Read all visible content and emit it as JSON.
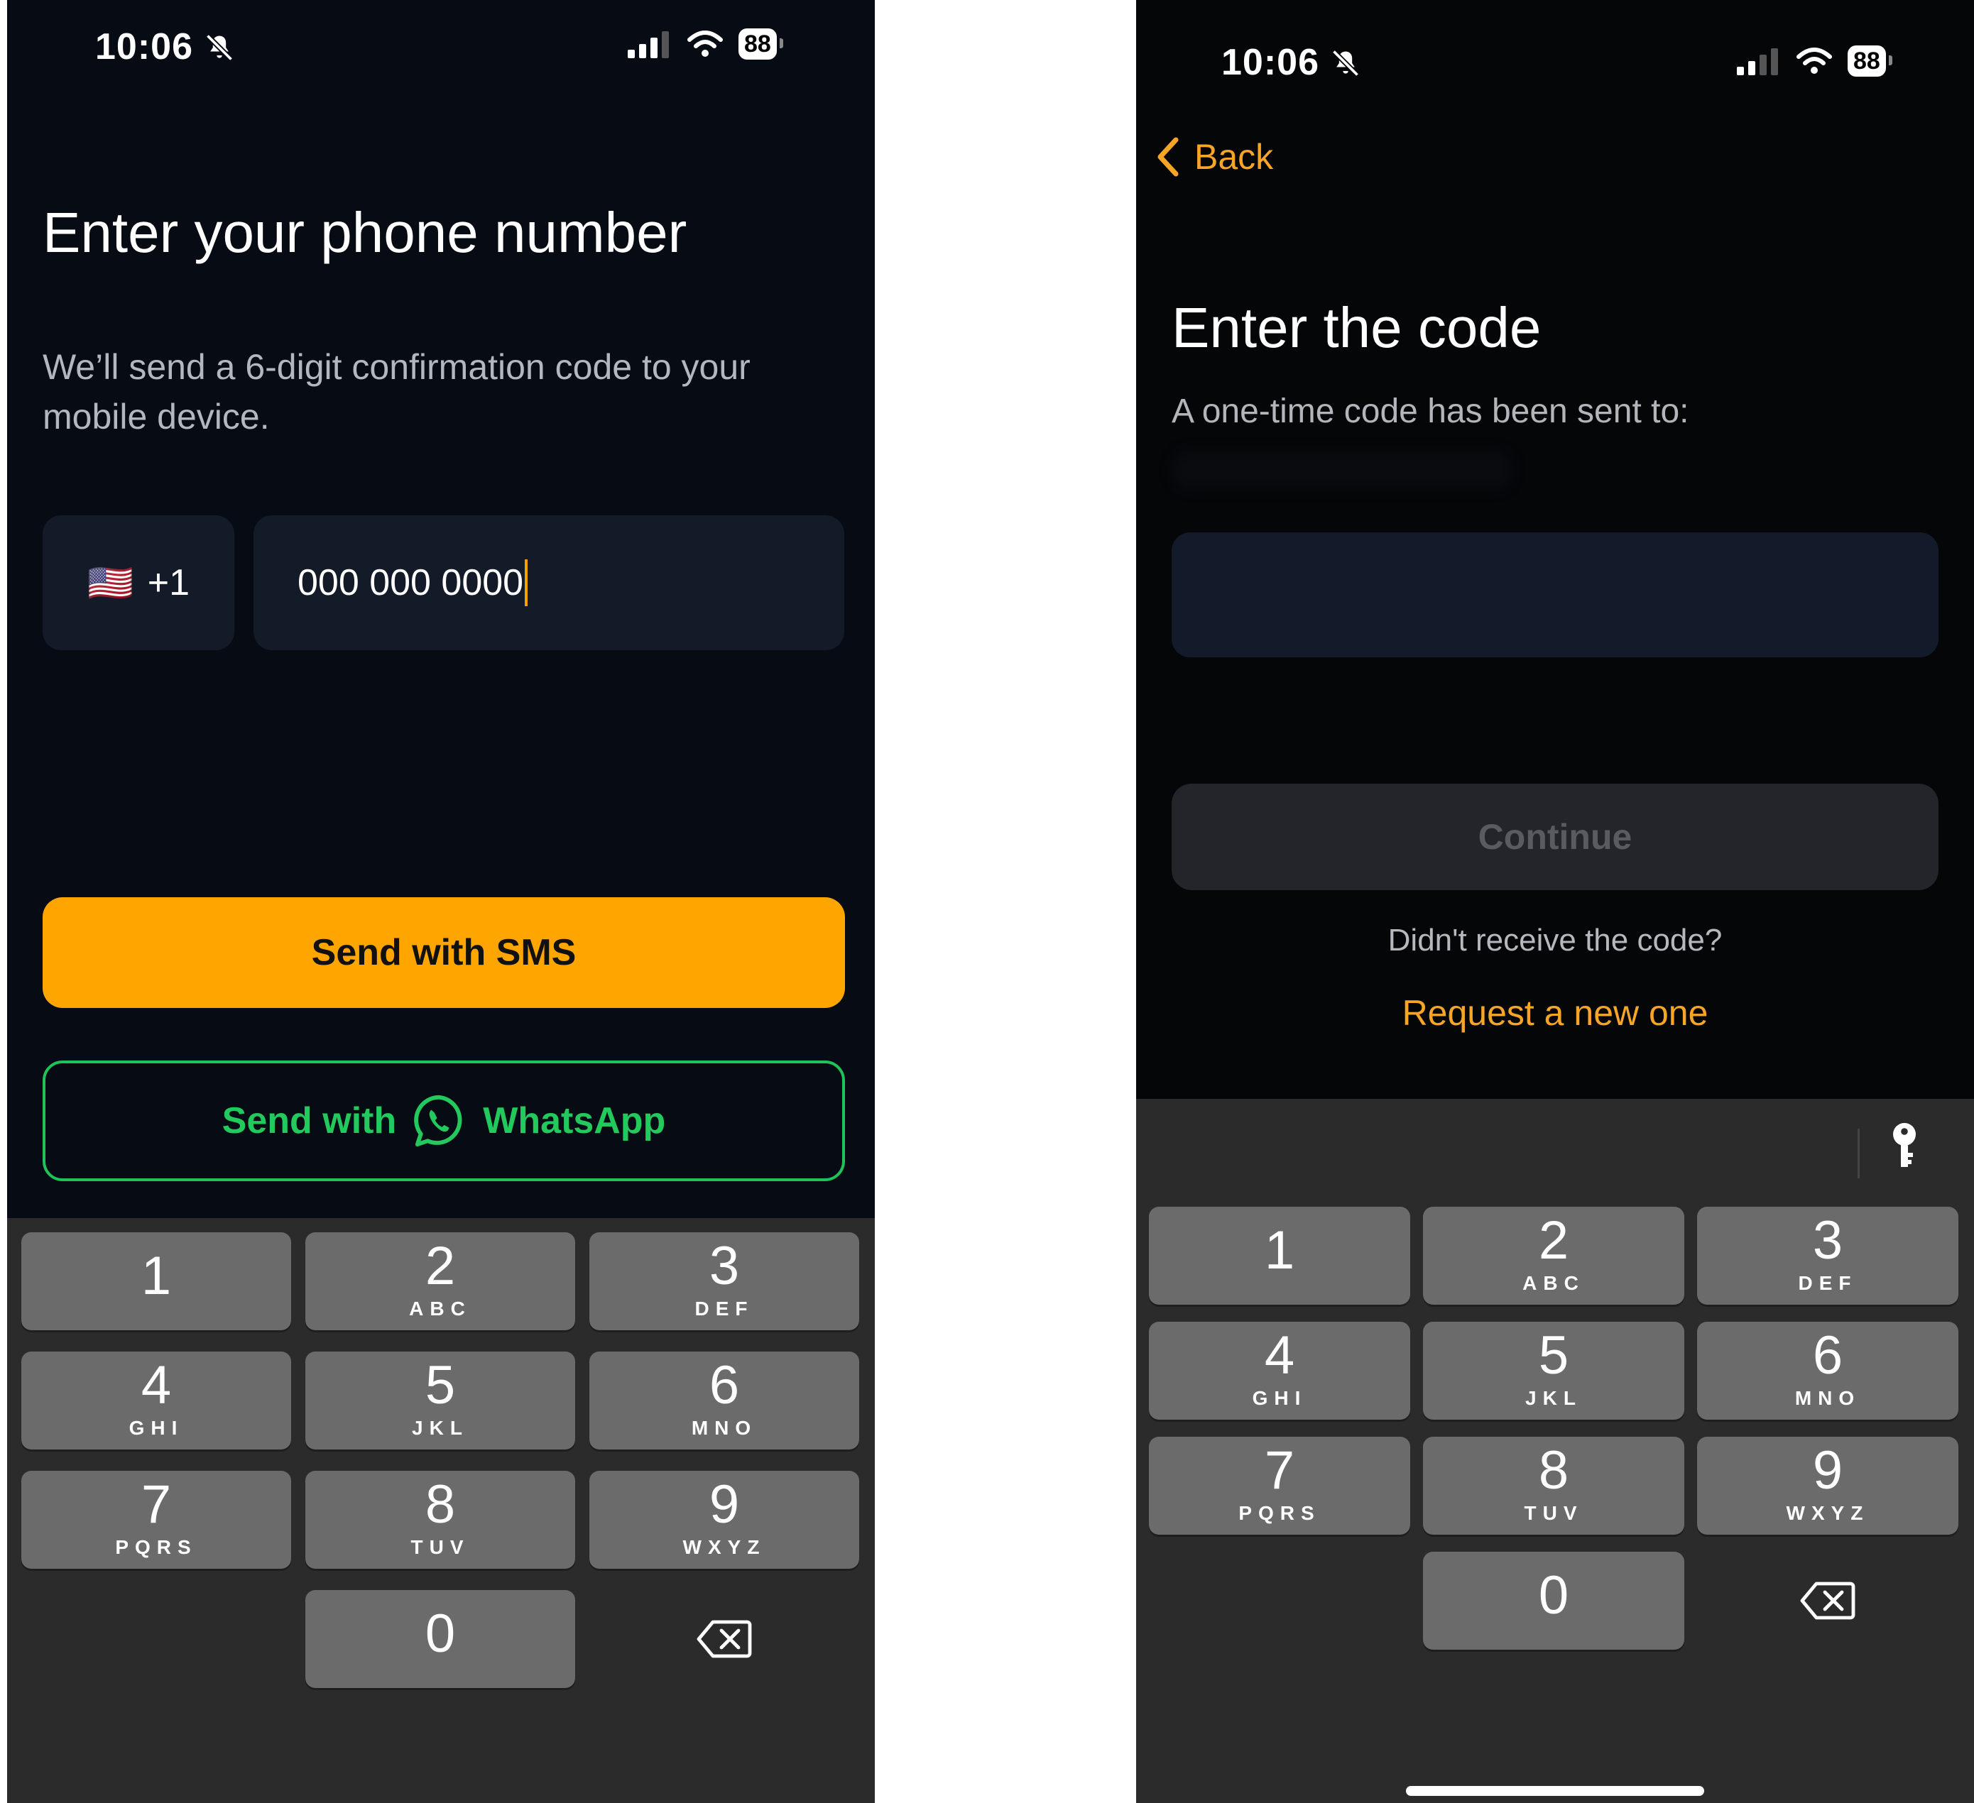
{
  "left_screen": {
    "status": {
      "time": "10:06",
      "battery": "88"
    },
    "title": "Enter your phone number",
    "subtitle": "We’ll send a 6-digit confirmation code to your mobile device.",
    "country": {
      "flag": "🇺🇸",
      "code": "+1"
    },
    "phone_input": {
      "value": "000 000 0000"
    },
    "sms_button": "Send with SMS",
    "whatsapp_button": {
      "prefix": "Send with",
      "brand": "WhatsApp"
    },
    "colors": {
      "accent": "#fea500",
      "whatsapp": "#22c95c",
      "background": "#070b13"
    }
  },
  "right_screen": {
    "status": {
      "time": "10:06",
      "battery": "88"
    },
    "back_label": "Back",
    "title": "Enter the code",
    "subtitle": "A one-time code has been sent to:",
    "code_input": {
      "value": ""
    },
    "continue_button": "Continue",
    "didnt_receive": "Didn't receive the code?",
    "request_link": "Request a new one",
    "colors": {
      "accent": "#f7a527",
      "background": "#050608"
    }
  },
  "keypad": {
    "keys": [
      {
        "digit": "1",
        "letters": ""
      },
      {
        "digit": "2",
        "letters": "ABC"
      },
      {
        "digit": "3",
        "letters": "DEF"
      },
      {
        "digit": "4",
        "letters": "GHI"
      },
      {
        "digit": "5",
        "letters": "JKL"
      },
      {
        "digit": "6",
        "letters": "MNO"
      },
      {
        "digit": "7",
        "letters": "PQRS"
      },
      {
        "digit": "8",
        "letters": "TUV"
      },
      {
        "digit": "9",
        "letters": "WXYZ"
      },
      {
        "digit": "0",
        "letters": ""
      }
    ]
  }
}
